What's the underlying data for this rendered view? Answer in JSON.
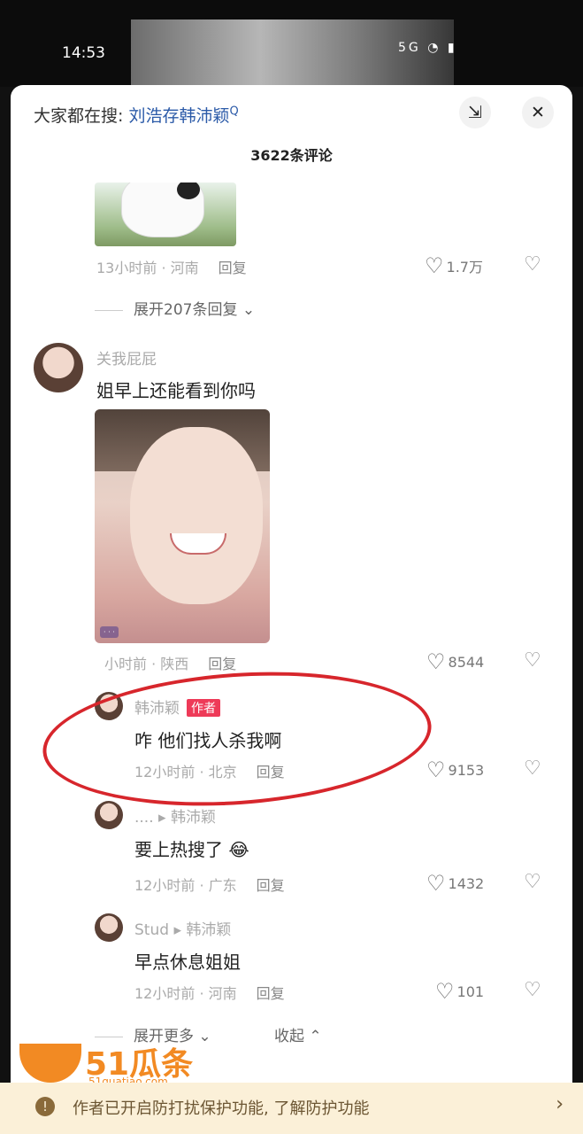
{
  "status": {
    "time": "14:53",
    "icons": "5G ◔ ▮"
  },
  "header": {
    "search_prefix": "大家都在搜:",
    "search_keyword": "刘浩存韩沛颖",
    "search_icon": "Q",
    "count": "3622条评论"
  },
  "top_comment": {
    "meta": "13小时前 · 河南",
    "reply": "回复",
    "likes": "1.7万",
    "expand": "展开207条回复"
  },
  "comment2": {
    "user": "关我屁屁",
    "text": "姐早上还能看到你吗",
    "meta": "小时前 · 陕西",
    "reply": "回复",
    "likes": "8544"
  },
  "replies": [
    {
      "user": "韩沛颖",
      "tag": "作者",
      "text": "咋 他们找人杀我啊",
      "meta": "12小时前 · 北京",
      "reply": "回复",
      "likes": "9153"
    },
    {
      "user": "....",
      "to": "韩沛颖",
      "text": "要上热搜了",
      "meta": "12小时前 · 广东",
      "reply": "回复",
      "likes": "1432"
    },
    {
      "user": "Stud",
      "to": "韩沛颖",
      "text": "早点休息姐姐",
      "meta": "12小时前 · 河南",
      "reply": "回复",
      "likes": "101"
    }
  ],
  "footer_actions": {
    "more": "展开更多",
    "collapse": "收起"
  },
  "notice": {
    "text": "作者已开启防打扰保护功能, 了解防护功能"
  },
  "watermark": {
    "title": "51瓜条",
    "url": "51guatiao.com"
  },
  "colors": {
    "accent": "#ee3a58",
    "annotation": "#d7262c",
    "link": "#2b5aa8"
  }
}
